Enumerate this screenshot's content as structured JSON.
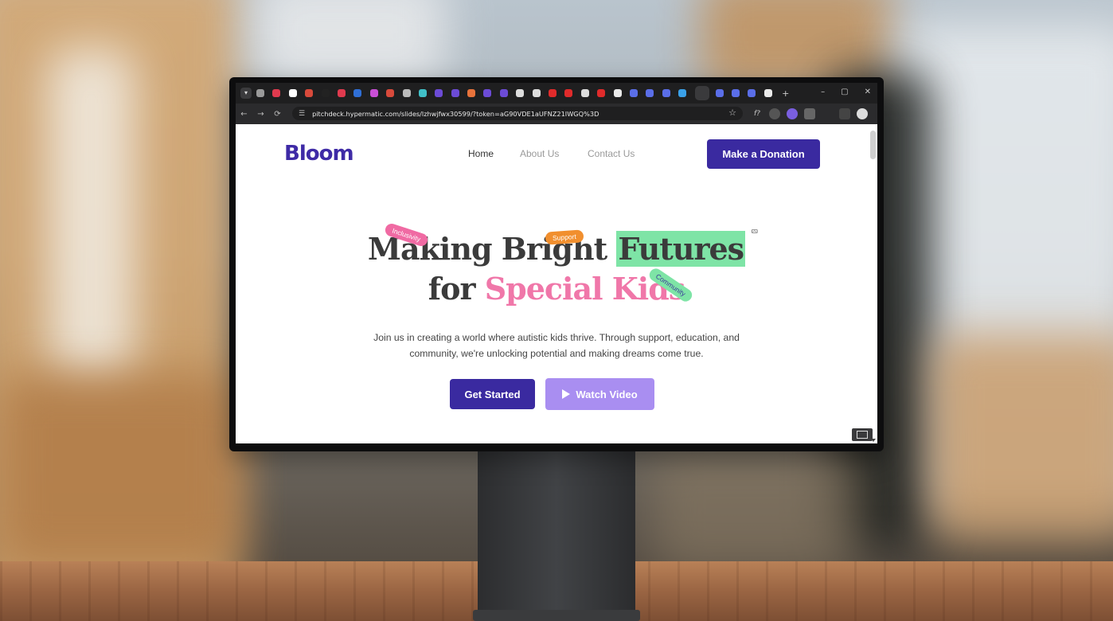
{
  "browser": {
    "url": "pitchdeck.hypermatic.com/slides/lzhwjfwx30599/?token=aG90VDE1aUFNZ21IWGQ%3D",
    "new_tab_label": "+",
    "window_controls": [
      "–",
      "▢",
      "✕"
    ]
  },
  "site": {
    "logo": "Bloom",
    "nav": {
      "home": "Home",
      "about": "About Us",
      "contact": "Contact Us"
    },
    "donate_label": "Make a Donation"
  },
  "hero": {
    "line1_a": "Making Bright ",
    "line1_b": "Futures",
    "line2_a": "for ",
    "line2_b": "Special Kids",
    "tags": {
      "inclusivity": "Inclusivity",
      "support": "Support",
      "community": "Community"
    },
    "subtext": "Join us in creating a world where autistic kids thrive. Through support, education, and community, we're unlocking potential and making dreams come true.",
    "get_started": "Get Started",
    "watch_video": "Watch Video"
  },
  "colors": {
    "brand_purple": "#3a2aa0",
    "accent_pink": "#f077a9",
    "accent_green": "#7ee4a6",
    "accent_orange": "#f18f2e",
    "video_button": "#a98ef1"
  },
  "icons": {
    "tab_menu": "chevron-down-icon",
    "back": "arrow-left-icon",
    "forward": "arrow-right-icon",
    "reload": "reload-icon",
    "site_info": "tune-icon",
    "bookmark": "star-icon",
    "play": "play-icon",
    "cursor": "mouse-pointer-icon"
  }
}
